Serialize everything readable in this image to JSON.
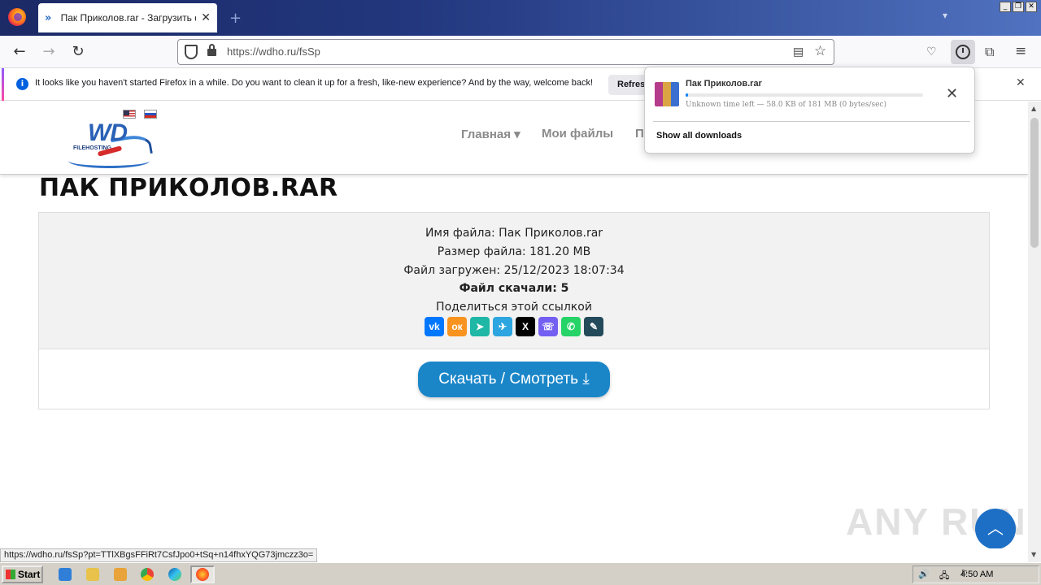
{
  "browser": {
    "tab_title": "Пак Приколов.rar - Загрузить фа",
    "url": "https://wdho.ru/fsSp",
    "notification": {
      "text": "It looks like you haven't started Firefox in a while. Do you want to clean it up for a fresh, like-new experience? And by the way, welcome back!",
      "button_label": "Refresh"
    },
    "status_url": "https://wdho.ru/fsSp?pt=TTlXBgsFFiRt7CsfJpo0+tSq+n14fhxYQG73jmczz3o="
  },
  "downloads_panel": {
    "file_name": "Пак Приколов.rar",
    "status": "Unknown time left — 58.0 KB of 181 MB (0 bytes/sec)",
    "progress": 0.0003,
    "show_all": "Show all downloads"
  },
  "site": {
    "logo_text": "WD",
    "logo_subtext": "FILEHOSTING",
    "menu": [
      "Главная ▾",
      "Мои файлы",
      "П"
    ],
    "title": "ПАК ПРИКОЛОВ.RAR",
    "info": {
      "file_name": "Имя файла: Пак Приколов.rar",
      "file_size": "Размер файла: 181.20 MB",
      "uploaded": "Файл загружен: 25/12/2023 18:07:34",
      "downloads": "Файл скачали: 5",
      "share": "Поделиться этой ссылкой"
    },
    "download_button": "Скачать / Смотреть"
  },
  "watermark": "ANY RUN",
  "taskbar": {
    "start": "Start",
    "clock": "4:50 AM"
  },
  "colors": {
    "accent": "#1a86c8",
    "firefox_blue": "#0a84ff"
  }
}
